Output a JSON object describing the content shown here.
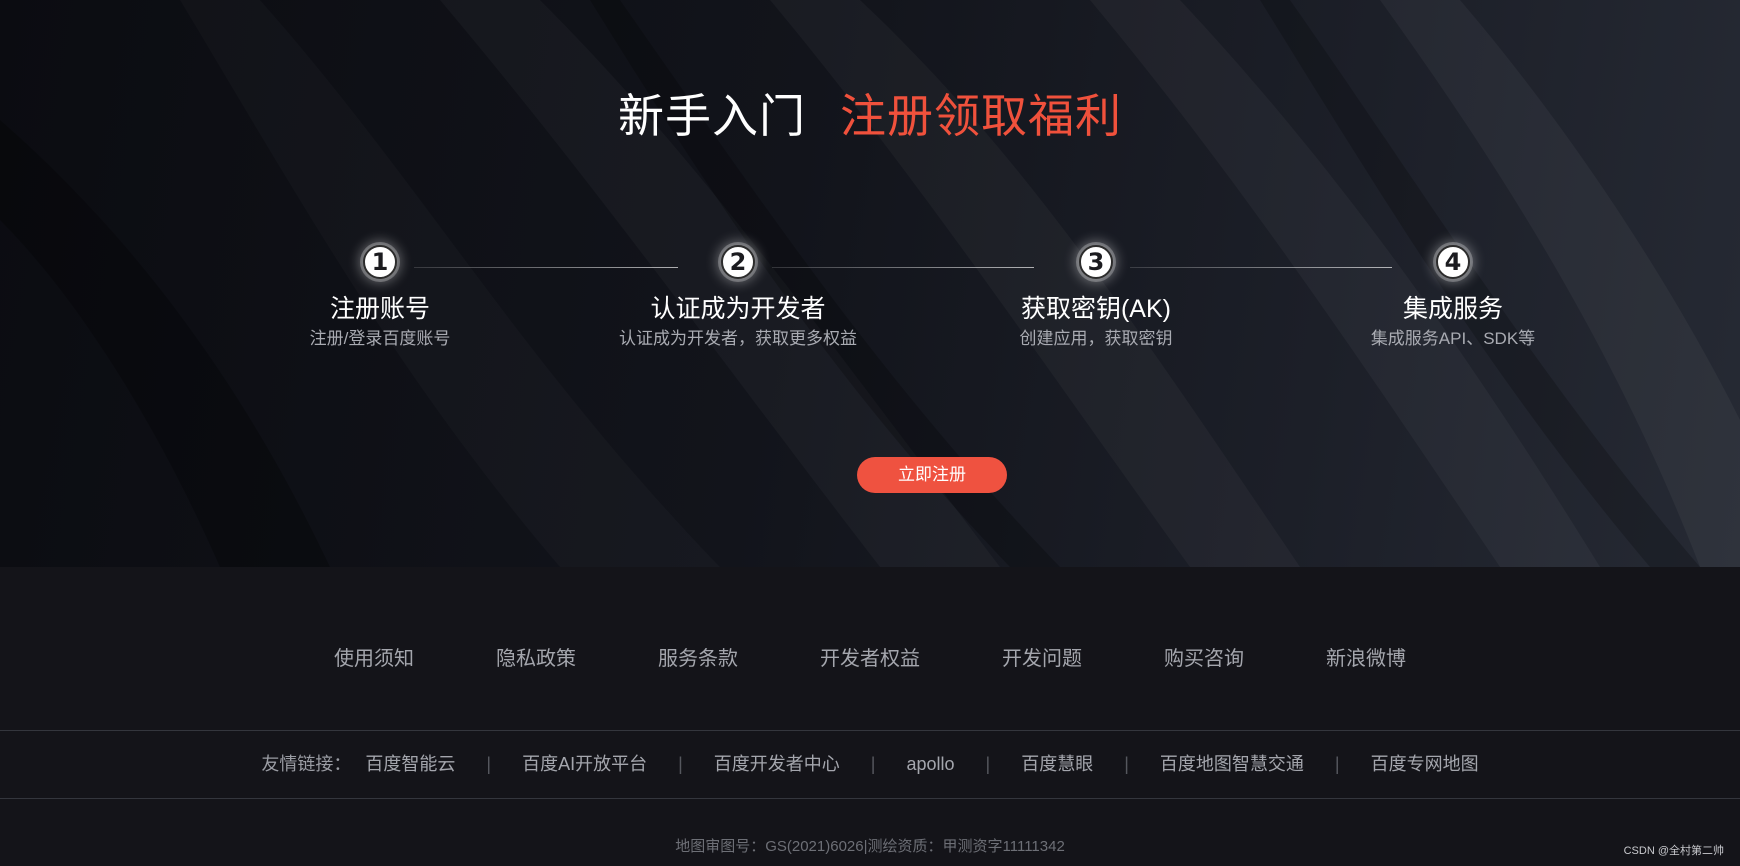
{
  "hero": {
    "title_white": "新手入门",
    "title_red": "注册领取福利",
    "steps": [
      {
        "number": "1",
        "title": "注册账号",
        "desc": "注册/登录百度账号"
      },
      {
        "number": "2",
        "title": "认证成为开发者",
        "desc": "认证成为开发者，获取更多权益"
      },
      {
        "number": "3",
        "title": "获取密钥(AK)",
        "desc": "创建应用，获取密钥"
      },
      {
        "number": "4",
        "title": "集成服务",
        "desc": "集成服务API、SDK等"
      }
    ],
    "register_button": "立即注册"
  },
  "footer": {
    "nav": [
      "使用须知",
      "隐私政策",
      "服务条款",
      "开发者权益",
      "开发问题",
      "购买咨询",
      "新浪微博"
    ],
    "friend_links_label": "友情链接：",
    "friend_links": [
      "百度智能云",
      "百度AI开放平台",
      "百度开发者中心",
      "apollo",
      "百度慧眼",
      "百度地图智慧交通",
      "百度专网地图"
    ],
    "separator": "|",
    "copyright": "地图审图号：GS(2021)6026|测绘资质：甲测资字11111342",
    "watermark": "CSDN @全村第二帅"
  },
  "colors": {
    "accent_red": "#ef5240",
    "hero_background": "#12141b",
    "footer_background": "#141419"
  }
}
